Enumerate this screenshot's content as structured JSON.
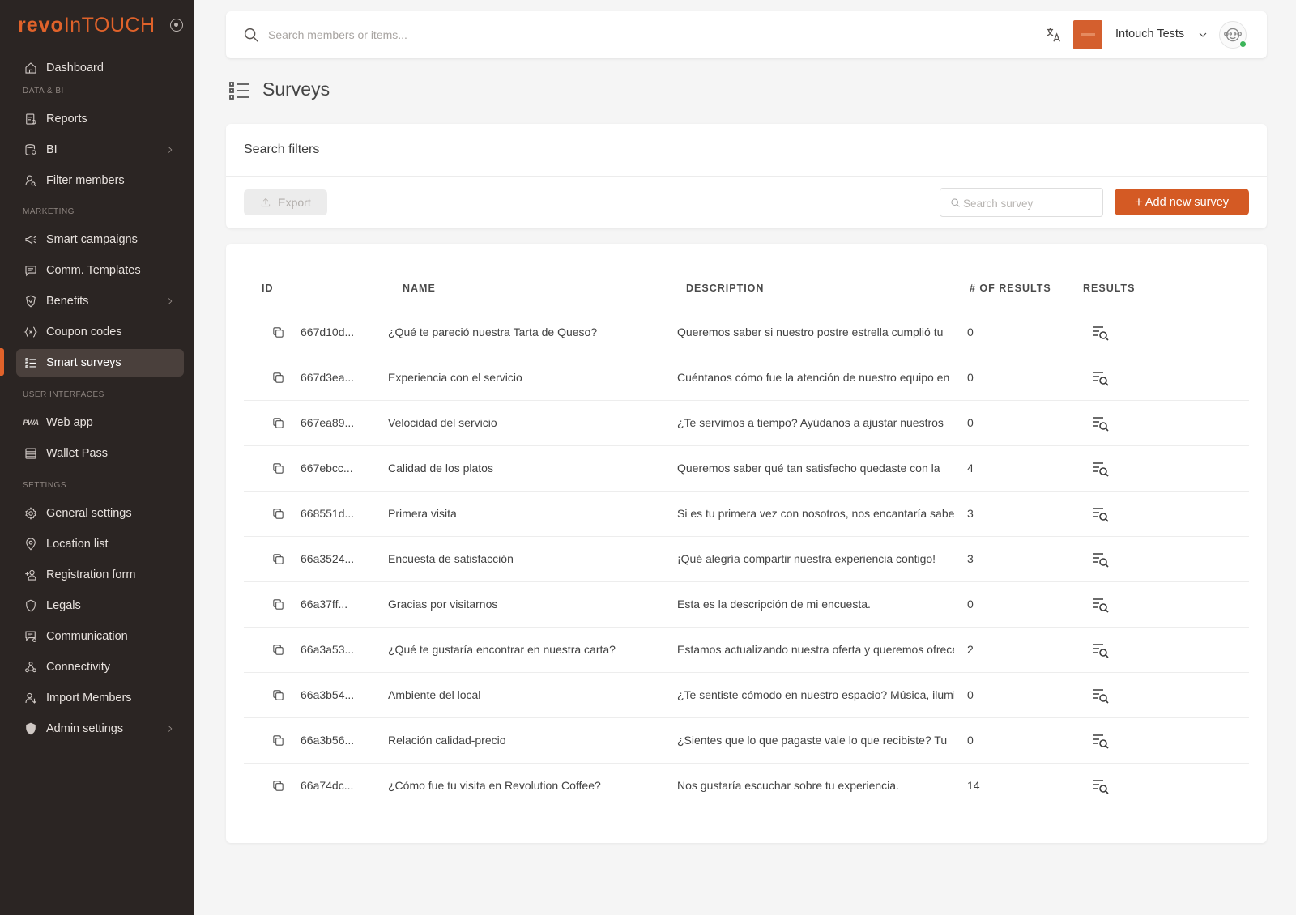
{
  "app": {
    "logo_bold": "revo",
    "logo_thin": "InTOUCH"
  },
  "sidebar": {
    "items": [
      {
        "key": "dashboard",
        "label": "Dashboard",
        "icon": "home-icon"
      },
      {
        "key": "reports",
        "label": "Reports",
        "icon": "report-icon"
      },
      {
        "key": "bi",
        "label": "BI",
        "icon": "database-icon"
      },
      {
        "key": "filter-members",
        "label": "Filter members",
        "icon": "user-search-icon"
      },
      {
        "key": "smart-campaigns",
        "label": "Smart campaigns",
        "icon": "megaphone-icon"
      },
      {
        "key": "comm-templates",
        "label": "Comm. Templates",
        "icon": "message-icon"
      },
      {
        "key": "benefits",
        "label": "Benefits",
        "icon": "badge-icon"
      },
      {
        "key": "coupon-codes",
        "label": "Coupon codes",
        "icon": "braces-icon"
      },
      {
        "key": "smart-surveys",
        "label": "Smart surveys",
        "icon": "list-icon"
      },
      {
        "key": "web-app",
        "label": "Web app",
        "icon": "pwa-icon"
      },
      {
        "key": "wallet-pass",
        "label": "Wallet Pass",
        "icon": "pass-icon"
      },
      {
        "key": "general-settings",
        "label": "General settings",
        "icon": "gear-icon"
      },
      {
        "key": "location-list",
        "label": "Location list",
        "icon": "location-pin-icon"
      },
      {
        "key": "registration-form",
        "label": "Registration form",
        "icon": "user-plus-icon"
      },
      {
        "key": "legals",
        "label": "Legals",
        "icon": "shield-icon"
      },
      {
        "key": "communication",
        "label": "Communication",
        "icon": "chat-settings-icon"
      },
      {
        "key": "connectivity",
        "label": "Connectivity",
        "icon": "webhook-icon"
      },
      {
        "key": "import-members",
        "label": "Import Members",
        "icon": "user-import-icon"
      },
      {
        "key": "admin-settings",
        "label": "Admin settings",
        "icon": "admin-shield-icon"
      }
    ],
    "sections": {
      "data_bi": "DATA & BI",
      "marketing": "MARKETING",
      "user_interfaces": "USER INTERFACES",
      "settings": "SETTINGS"
    },
    "active_item": "Smart surveys"
  },
  "topbar": {
    "search_placeholder": "Search members or items...",
    "account_name": "Intouch Tests"
  },
  "page": {
    "title": "Surveys"
  },
  "filters": {
    "title": "Search filters",
    "export_label": "Export",
    "search_placeholder": "Search survey",
    "add_label": "Add new survey"
  },
  "table": {
    "columns": [
      "ID",
      "NAME",
      "DESCRIPTION",
      "# OF RESULTS",
      "RESULTS"
    ],
    "rows": [
      {
        "id": "667d10d...",
        "name": "¿Qué te pareció nuestra Tarta de Queso?",
        "description": "Queremos saber si nuestro postre estrella cumplió tu",
        "results": "0"
      },
      {
        "id": "667d3ea...",
        "name": "Experiencia con el servicio",
        "description": "Cuéntanos cómo fue la atención de nuestro equipo en",
        "results": "0"
      },
      {
        "id": "667ea89...",
        "name": "Velocidad del servicio",
        "description": "¿Te servimos a tiempo? Ayúdanos a ajustar nuestros",
        "results": "0"
      },
      {
        "id": "667ebcc...",
        "name": "Calidad de los platos",
        "description": "Queremos saber qué tan satisfecho quedaste con la",
        "results": "4"
      },
      {
        "id": "668551d...",
        "name": "Primera visita",
        "description": "Si es tu primera vez con nosotros, nos encantaría saber",
        "results": "3"
      },
      {
        "id": "66a3524...",
        "name": "Encuesta de satisfacción",
        "description": "¡Qué alegría compartir nuestra experiencia contigo!",
        "results": "3"
      },
      {
        "id": "66a37ff...",
        "name": "Gracias por visitarnos",
        "description": "Esta es la descripción de mi encuesta.",
        "results": "0"
      },
      {
        "id": "66a3a53...",
        "name": "¿Qué te gustaría encontrar en nuestra carta?",
        "description": "Estamos actualizando nuestra oferta y queremos ofrecerte",
        "results": "2"
      },
      {
        "id": "66a3b54...",
        "name": "Ambiente del local",
        "description": "¿Te sentiste cómodo en nuestro espacio? Música, iluminación",
        "results": "0"
      },
      {
        "id": "66a3b56...",
        "name": "Relación calidad-precio",
        "description": "¿Sientes que lo que pagaste vale lo que recibiste? Tu",
        "results": "0"
      },
      {
        "id": "66a74dc...",
        "name": "¿Cómo fue tu visita en Revolution Coffee?",
        "description": "Nos gustaría escuchar sobre tu experiencia.",
        "results": "14"
      }
    ]
  },
  "colors": {
    "brand": "#d45a24",
    "sidebar_bg": "#2b2523",
    "active_bg": "#4a403c",
    "online": "#3db55a"
  }
}
